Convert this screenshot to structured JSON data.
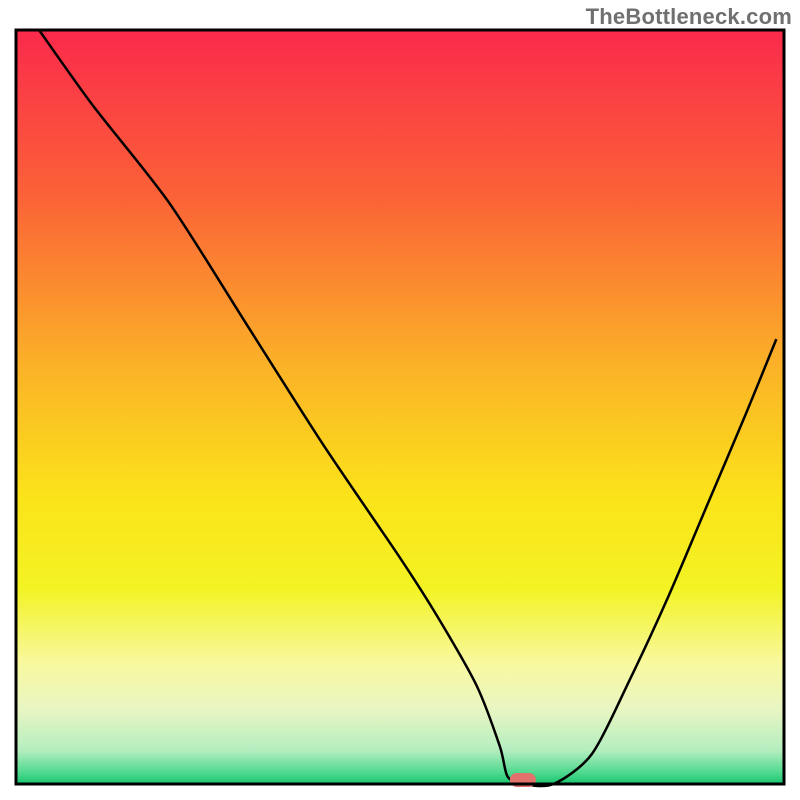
{
  "watermark": "TheBottleneck.com",
  "chart_data": {
    "type": "line",
    "title": "",
    "xlabel": "",
    "ylabel": "",
    "xlim": [
      0,
      100
    ],
    "ylim": [
      0,
      100
    ],
    "x": [
      3,
      10,
      20,
      30,
      40,
      50,
      55,
      60,
      63,
      64,
      66,
      70,
      75,
      80,
      85,
      90,
      95,
      99
    ],
    "values": [
      100,
      90,
      77,
      61,
      45,
      30,
      22,
      13,
      5,
      1,
      0,
      0,
      4,
      14,
      25,
      37,
      49,
      59
    ],
    "curve_note": "V-shaped bottleneck curve with minimum around x≈65–68",
    "marker": {
      "x_pct": 66,
      "y_pct": 0,
      "color": "#e3716b"
    },
    "gradient_stops": [
      {
        "offset": 0.0,
        "color": "#fb2a4c"
      },
      {
        "offset": 0.22,
        "color": "#fb6237"
      },
      {
        "offset": 0.45,
        "color": "#fbb327"
      },
      {
        "offset": 0.62,
        "color": "#fbe31a"
      },
      {
        "offset": 0.74,
        "color": "#f3f323"
      },
      {
        "offset": 0.84,
        "color": "#f8f89f"
      },
      {
        "offset": 0.9,
        "color": "#e9f6c2"
      },
      {
        "offset": 0.955,
        "color": "#b5eec0"
      },
      {
        "offset": 0.985,
        "color": "#4fd98e"
      },
      {
        "offset": 1.0,
        "color": "#18c56f"
      }
    ],
    "frame_color": "#000000",
    "curve_color": "#000000"
  }
}
